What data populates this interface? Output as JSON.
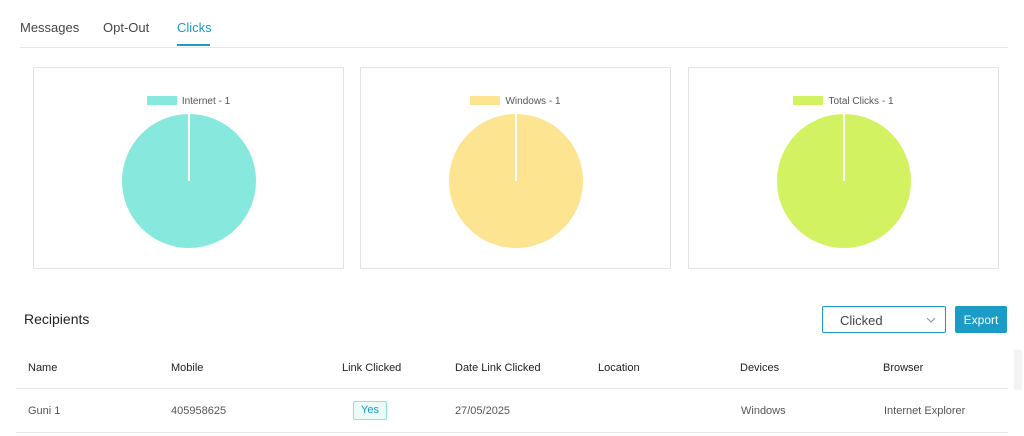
{
  "tabs": [
    {
      "label": "Messages",
      "active": false
    },
    {
      "label": "Opt-Out",
      "active": false
    },
    {
      "label": "Clicks",
      "active": true
    }
  ],
  "charts": [
    {
      "legend": "Internet - 1",
      "color": "#87e8de"
    },
    {
      "legend": "Windows - 1",
      "color": "#fde490"
    },
    {
      "legend": "Total Clicks - 1",
      "color": "#d3f261"
    }
  ],
  "chart_data": [
    {
      "type": "pie",
      "categories": [
        "Internet"
      ],
      "values": [
        1
      ],
      "legend": "top",
      "colors": [
        "#87e8de"
      ]
    },
    {
      "type": "pie",
      "categories": [
        "Windows"
      ],
      "values": [
        1
      ],
      "legend": "top",
      "colors": [
        "#fde490"
      ]
    },
    {
      "type": "pie",
      "categories": [
        "Total Clicks"
      ],
      "values": [
        1
      ],
      "legend": "top",
      "colors": [
        "#d3f261"
      ]
    }
  ],
  "recipients": {
    "title": "Recipients",
    "filter": {
      "selected": "Clicked",
      "icon": "chevron-down-icon"
    },
    "export_label": "Export",
    "columns": [
      "Name",
      "Mobile",
      "Link Clicked",
      "Date Link Clicked",
      "Location",
      "Devices",
      "Browser"
    ],
    "rows": [
      {
        "name": "Guni 1",
        "mobile": "405958625",
        "link_clicked": "Yes",
        "date": "27/05/2025",
        "location": "",
        "device": "Windows",
        "browser": "Internet Explorer"
      }
    ]
  },
  "colors": {
    "accent": "#1a9cc7",
    "badge_border": "#8ee6d9",
    "badge_bg": "#eafbf8"
  }
}
